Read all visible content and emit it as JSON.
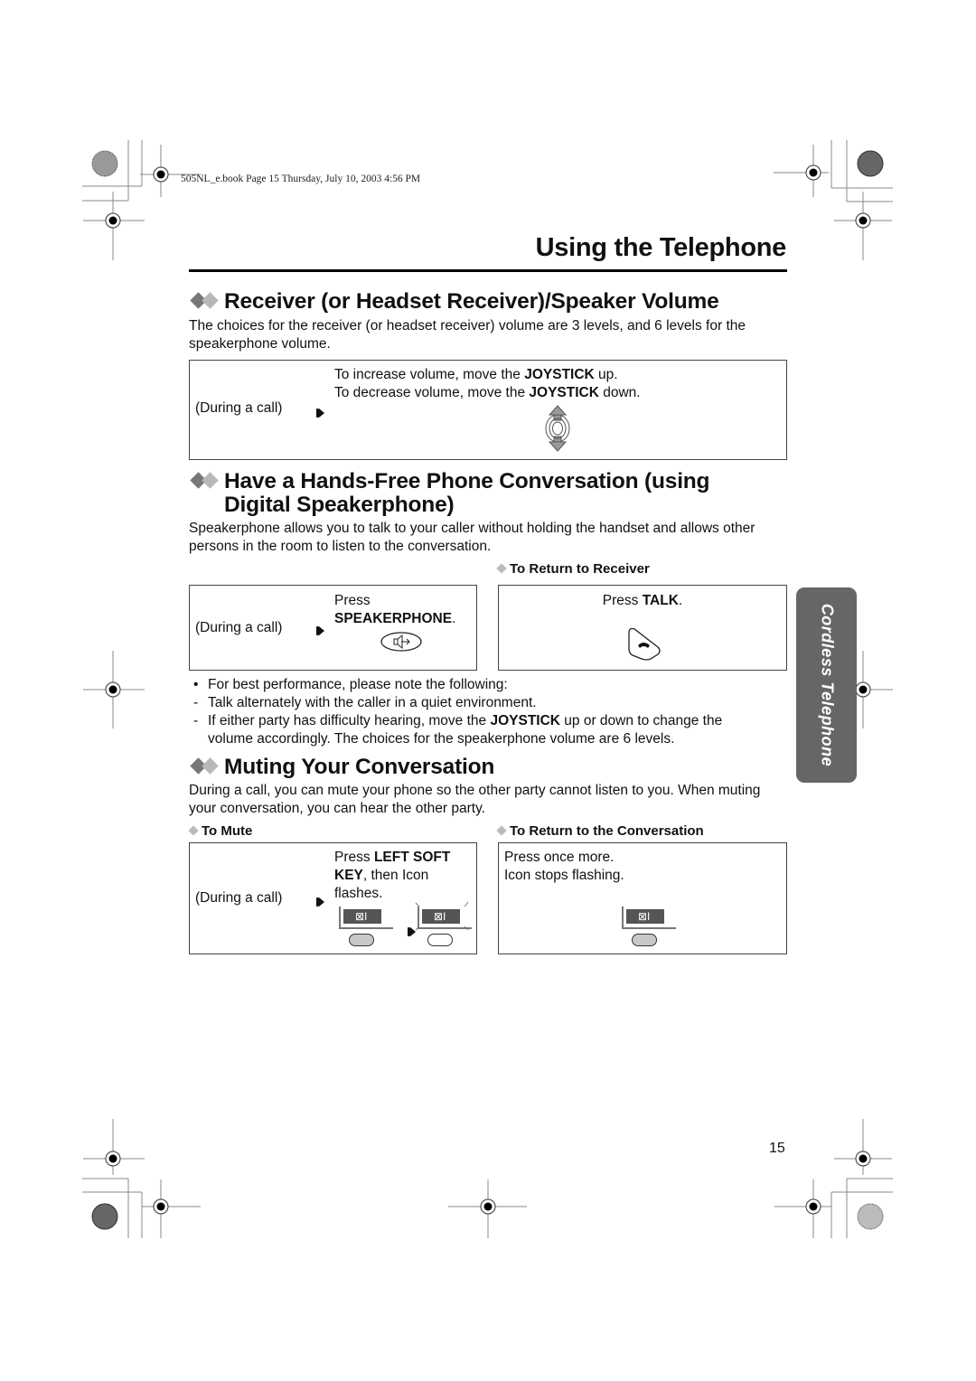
{
  "header": {
    "print_meta": "505NL_e.book  Page 15  Thursday, July 10, 2003  4:56 PM"
  },
  "page": {
    "title": "Using the Telephone",
    "number": "15",
    "side_tab": "Cordless Telephone"
  },
  "volume_section": {
    "heading": "Receiver (or Headset Receiver)/Speaker Volume",
    "intro": "The choices for the receiver (or headset receiver) volume are 3 levels, and 6 levels for the speakerphone volume.",
    "box": {
      "condition": "(During a call)",
      "line1_pre": "To increase volume, move the ",
      "line1_key": "JOYSTICK",
      "line1_post": " up.",
      "line2_pre": "To decrease volume, move the ",
      "line2_key": "JOYSTICK",
      "line2_post": " down.",
      "icon": "joystick-up-down-icon"
    }
  },
  "handsfree_section": {
    "heading_line1": "Have a Hands-Free Phone Conversation (using",
    "heading_line2": "Digital Speakerphone)",
    "intro": "Speakerphone allows you to talk to your caller without holding the handset and allows other persons in the room to listen to the conversation.",
    "left_box": {
      "condition": "(During a call)",
      "press": "Press",
      "key": "SPEAKERPHONE",
      "key_suffix": ".",
      "icon": "speakerphone-button-icon"
    },
    "right_box": {
      "subheading": "To Return to Receiver",
      "press": "Press ",
      "key": "TALK",
      "key_suffix": ".",
      "icon": "talk-button-icon"
    },
    "notes": {
      "bullet": "For best performance, please note the following:",
      "dash1": "Talk alternately with the caller in a quiet environment.",
      "dash2_pre": "If either party has difficulty hearing, move the ",
      "dash2_key": "JOYSTICK",
      "dash2_post": " up or down to change the",
      "dash2_cont": "volume accordingly. The choices for the speakerphone volume are 6 levels."
    }
  },
  "mute_section": {
    "heading": "Muting Your Conversation",
    "intro": "During a call, you can mute your phone so the other party cannot listen to you. When muting your conversation, you can hear the other party.",
    "left_box": {
      "subheading": "To Mute",
      "condition": "(During a call)",
      "press": "Press ",
      "key_line1": "LEFT SOFT",
      "key_line2": "KEY",
      "after_key": ", then Icon",
      "line3": "flashes.",
      "icon_glyph": "⊠I"
    },
    "right_box": {
      "subheading": "To Return to the Conversation",
      "line1": "Press once more.",
      "line2": "Icon stops flashing.",
      "icon_glyph": "⊠I"
    }
  }
}
